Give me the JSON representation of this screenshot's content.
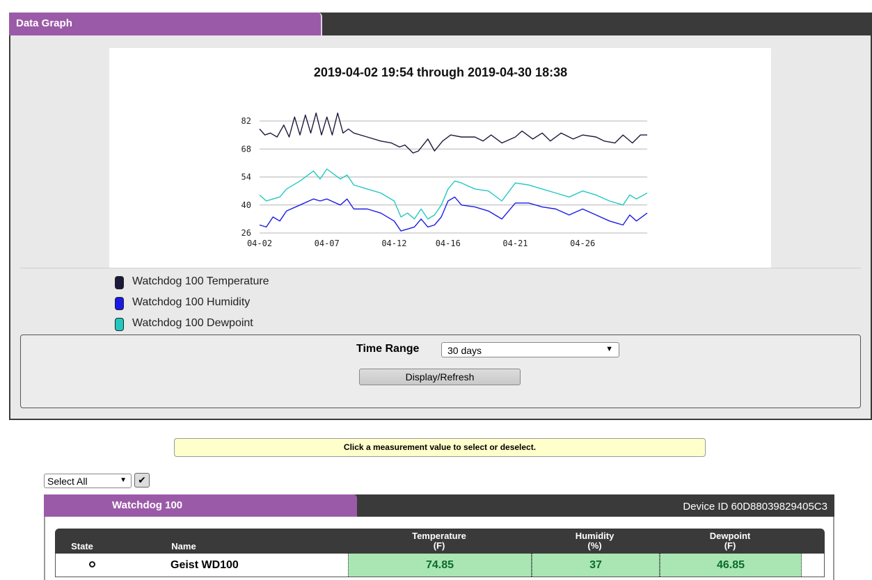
{
  "panel": {
    "title": "Data Graph"
  },
  "chart_data": {
    "type": "line",
    "title": "2019-04-02 19:54 through 2019-04-30 18:38",
    "x_tick_labels": [
      "04-02",
      "04-07",
      "04-12",
      "04-16",
      "04-21",
      "04-26"
    ],
    "x_tick_days": [
      2,
      7,
      12,
      16,
      21,
      26
    ],
    "x_range_days": [
      2,
      30.8
    ],
    "y_ticks": [
      26,
      40,
      54,
      68,
      82
    ],
    "ylim": [
      26,
      82
    ],
    "grid": true,
    "series": [
      {
        "name": "Watchdog 100 Temperature",
        "color": "#1c1a3a",
        "x": [
          2,
          2.4,
          2.8,
          3.3,
          3.8,
          4.2,
          4.6,
          5.0,
          5.4,
          5.8,
          6.2,
          6.6,
          7.0,
          7.4,
          7.8,
          8.2,
          8.6,
          9,
          10,
          11,
          11.8,
          12.4,
          12.8,
          13.4,
          13.8,
          14.5,
          15,
          15.6,
          16.2,
          17,
          18,
          18.6,
          19.2,
          20,
          21,
          21.5,
          22.3,
          23,
          23.6,
          24.4,
          25.3,
          26,
          27,
          27.6,
          28.4,
          29,
          29.7,
          30.3,
          30.8
        ],
        "values": [
          78,
          75,
          76,
          74,
          80,
          74,
          84,
          75,
          85,
          76,
          86,
          75,
          84,
          75,
          86,
          76,
          78,
          76,
          74,
          72,
          71,
          69,
          70,
          66,
          67,
          73,
          67,
          72,
          75,
          74,
          74,
          72,
          75,
          71,
          74,
          77,
          73,
          76,
          72,
          76,
          73,
          75,
          74,
          72,
          71,
          75,
          71,
          75,
          75
        ]
      },
      {
        "name": "Watchdog 100 Humidity",
        "color": "#1a1ae6",
        "x": [
          2,
          2.5,
          3,
          3.5,
          4,
          5,
          6,
          6.5,
          7,
          8,
          8.5,
          9,
          10,
          11,
          12,
          12.5,
          13,
          13.5,
          14,
          14.5,
          15,
          15.5,
          16,
          16.5,
          17,
          18,
          19,
          20,
          21,
          22,
          23,
          24,
          25,
          26,
          27,
          28,
          29,
          29.5,
          30,
          30.8
        ],
        "values": [
          30,
          29,
          34,
          32,
          37,
          40,
          43,
          42,
          43,
          40,
          43,
          38,
          38,
          36,
          32,
          27,
          28,
          29,
          33,
          29,
          30,
          34,
          42,
          44,
          40,
          39,
          37,
          33,
          41,
          41,
          39,
          38,
          35,
          38,
          35,
          32,
          30,
          35,
          32,
          36
        ]
      },
      {
        "name": "Watchdog 100 Dewpoint",
        "color": "#22c8c0",
        "x": [
          2,
          2.5,
          3,
          3.5,
          4,
          5,
          6,
          6.5,
          7,
          8,
          8.5,
          9,
          10,
          11,
          12,
          12.5,
          13,
          13.5,
          14,
          14.5,
          15,
          15.5,
          16,
          16.5,
          17,
          18,
          19,
          20,
          21,
          22,
          23,
          24,
          25,
          26,
          27,
          28,
          29,
          29.5,
          30,
          30.8
        ],
        "values": [
          45,
          42,
          43,
          44,
          48,
          52,
          57,
          53,
          58,
          53,
          55,
          50,
          48,
          46,
          42,
          34,
          36,
          33,
          38,
          33,
          35,
          40,
          48,
          52,
          51,
          48,
          47,
          42,
          51,
          50,
          48,
          46,
          44,
          47,
          45,
          42,
          40,
          45,
          43,
          46
        ]
      }
    ]
  },
  "legend": [
    {
      "label": "Watchdog 100 Temperature",
      "color": "#1c1a3a"
    },
    {
      "label": "Watchdog 100 Humidity",
      "color": "#1a1ae6"
    },
    {
      "label": "Watchdog 100 Dewpoint",
      "color": "#22c8c0"
    }
  ],
  "controls": {
    "time_range_label": "Time Range",
    "time_range_value": "30 days",
    "refresh_button": "Display/Refresh"
  },
  "notice": "Click a measurement value to select or deselect.",
  "select_all": {
    "value": "Select All",
    "check": "✔"
  },
  "device": {
    "name": "Watchdog 100",
    "id_text": "Device ID 60D88039829405C3",
    "columns": {
      "state": "State",
      "name": "Name",
      "temperature": "Temperature",
      "temperature_unit": "(F)",
      "humidity": "Humidity",
      "humidity_unit": "(%)",
      "dewpoint": "Dewpoint",
      "dewpoint_unit": "(F)"
    },
    "row": {
      "name": "Geist WD100",
      "temperature": "74.85",
      "humidity": "37",
      "dewpoint": "46.85"
    }
  }
}
